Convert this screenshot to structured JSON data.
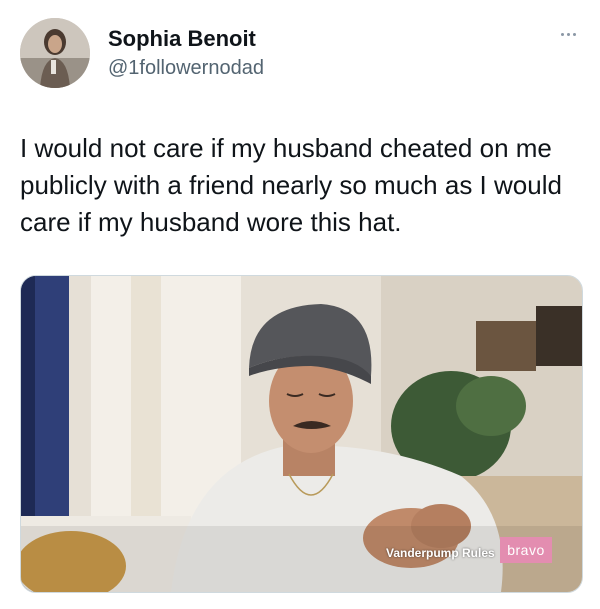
{
  "author": {
    "display_name": "Sophia Benoit",
    "handle": "@1followernodad"
  },
  "tweet": {
    "text": "I would not care if my husband cheated on me publicly with a friend nearly so much as I would care if my husband wore this hat."
  },
  "media": {
    "show_caption": "Vanderpump Rules",
    "network_caption": "bravo"
  },
  "icons": {
    "more": "more-options-icon"
  },
  "colors": {
    "handle": "#536471",
    "text": "#0f1419",
    "bravo": "#e38db0"
  }
}
